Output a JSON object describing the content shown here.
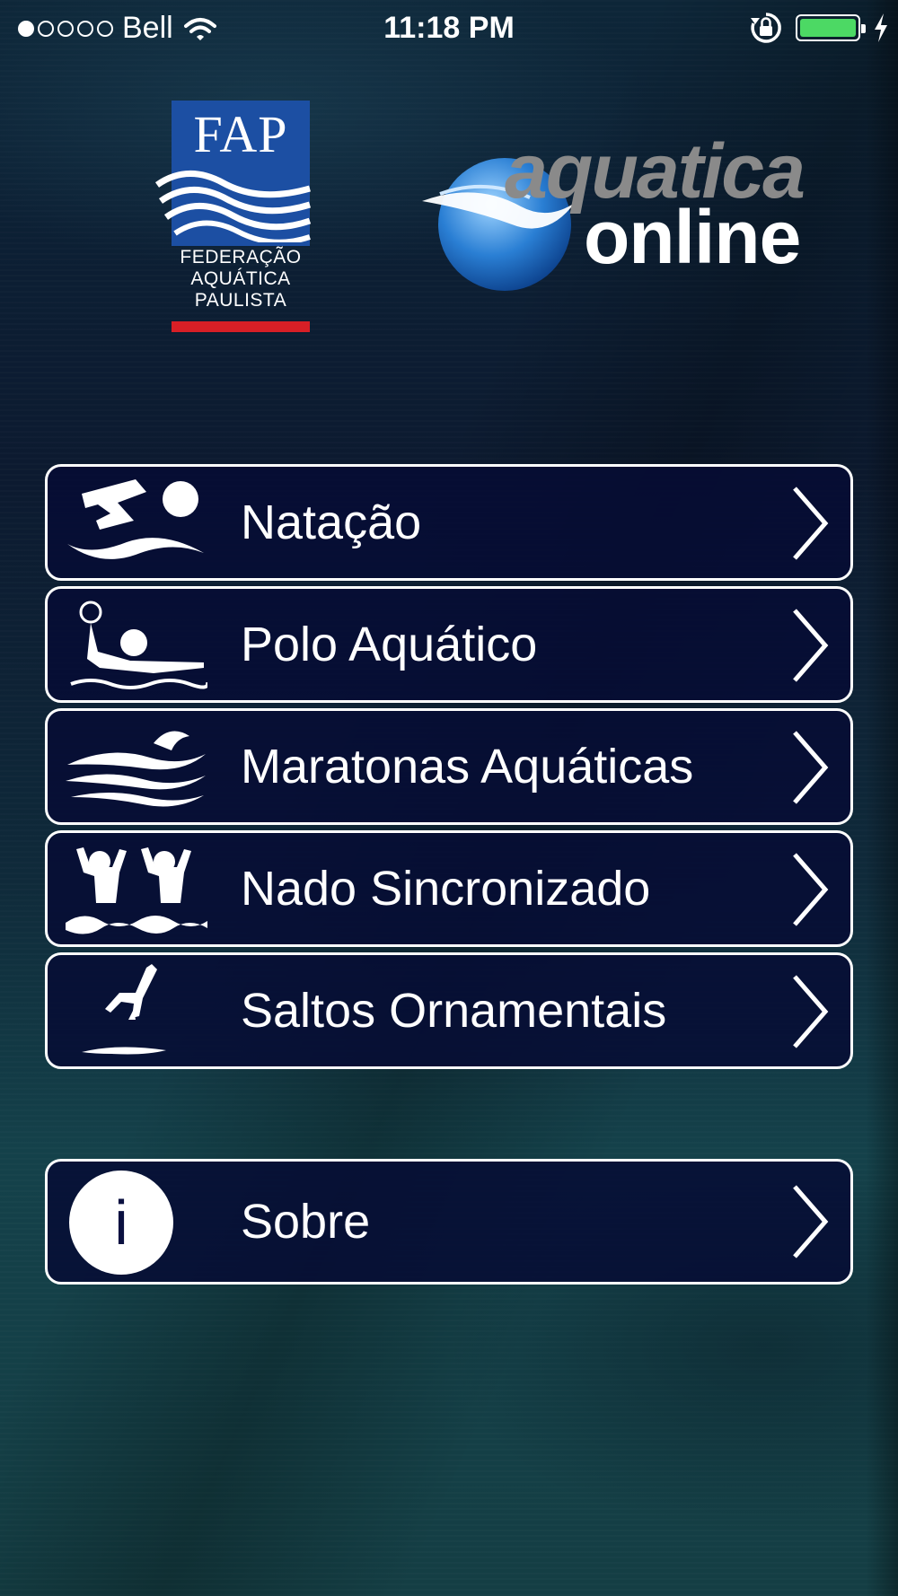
{
  "status_bar": {
    "signal_bars_filled": 1,
    "signal_bars_total": 5,
    "carrier": "Bell",
    "time": "11:18 PM",
    "battery_level": 1.0,
    "battery_color": "#4cd964"
  },
  "logos": {
    "fap": {
      "title": "FAP",
      "lines": [
        "FEDERAÇÃO",
        "AQUÁTICA",
        "PAULISTA"
      ],
      "box_color": "#1c4fa3",
      "stripe_color": "#d71f26"
    },
    "aquatica": {
      "word1": "aquatica",
      "word2": "online"
    }
  },
  "menu": {
    "items": [
      {
        "label": "Natação",
        "icon": "swimmer-icon"
      },
      {
        "label": "Polo Aquático",
        "icon": "water-polo-icon"
      },
      {
        "label": "Maratonas Aquáticas",
        "icon": "open-water-icon"
      },
      {
        "label": "Nado Sincronizado",
        "icon": "synchronized-swimming-icon"
      },
      {
        "label": "Saltos Ornamentais",
        "icon": "diving-icon"
      }
    ],
    "about": {
      "label": "Sobre",
      "icon": "info-icon",
      "icon_glyph": "i"
    }
  },
  "colors": {
    "button_bg": "#060c34",
    "button_border": "#ffffff"
  }
}
